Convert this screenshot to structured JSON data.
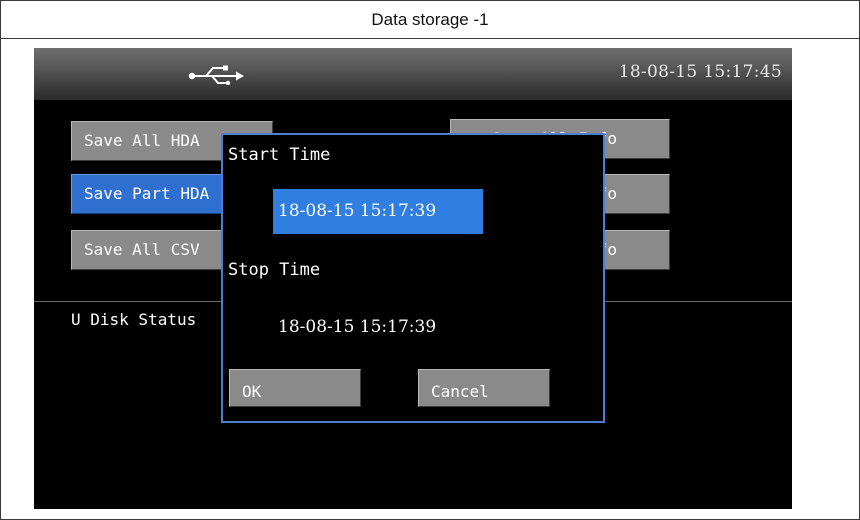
{
  "window": {
    "caption": "Data storage -1"
  },
  "titlebar": {
    "icon": "usb-icon",
    "datetime": "18-08-15 15:17:45"
  },
  "left_buttons": [
    {
      "label": "Save All HDA",
      "selected": false
    },
    {
      "label": "Save Part HDA",
      "selected": true
    },
    {
      "label": "Save All CSV",
      "selected": false
    }
  ],
  "right_buttons": [
    {
      "label": "Save All Info"
    },
    {
      "label": "Info"
    },
    {
      "label": "Info"
    }
  ],
  "status": {
    "label": "U Disk Status"
  },
  "dialog": {
    "start_label": "Start Time",
    "start_value": "18-08-15 15:17:39",
    "stop_label": "Stop Time",
    "stop_value": "18-08-15 15:17:39",
    "ok_label": "OK",
    "cancel_label": "Cancel"
  },
  "colors": {
    "accent": "#2f7ee0",
    "dialog_border": "#4a7fd4",
    "button_gray": "#8a8a8a",
    "screen_bg": "#000000"
  }
}
